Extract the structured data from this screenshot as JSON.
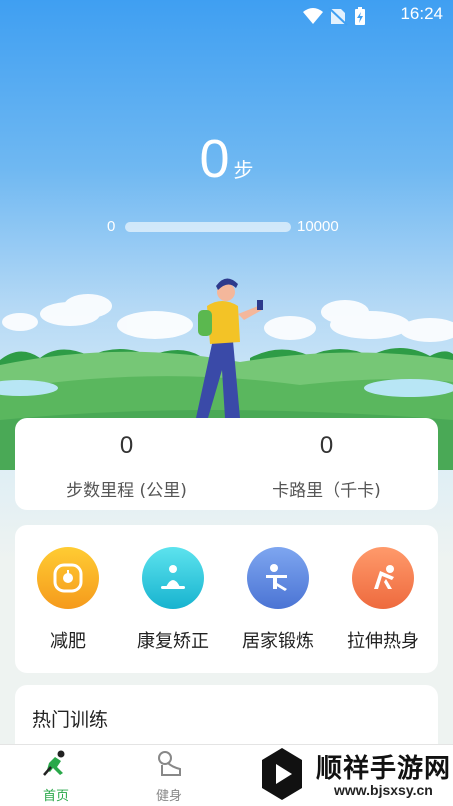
{
  "status_bar": {
    "time": "16:24"
  },
  "steps": {
    "count": "0",
    "unit": "步",
    "min": "0",
    "max": "10000",
    "progress": 0.0
  },
  "stats": [
    {
      "value": "0",
      "label": "步数里程 (公里)"
    },
    {
      "value": "0",
      "label": "卡路里（千卡)"
    }
  ],
  "features": [
    {
      "label": "减肥",
      "icon": "scale-icon",
      "color": "#f5a623"
    },
    {
      "label": "康复矫正",
      "icon": "meditation-icon",
      "color": "#27c8d8"
    },
    {
      "label": "居家锻炼",
      "icon": "exercise-icon",
      "color": "#5f8be0"
    },
    {
      "label": "拉伸热身",
      "icon": "stretch-icon",
      "color": "#f2784b"
    }
  ],
  "training": {
    "title": "热门训练"
  },
  "nav": [
    {
      "label": "首页",
      "icon": "running-icon",
      "active": true
    },
    {
      "label": "健身",
      "icon": "fitness-icon",
      "active": false
    }
  ],
  "watermark": {
    "title": "顺祥手游网",
    "subtitle": "www.bjsxsy.cn"
  },
  "colors": {
    "accent": "#2aa84a",
    "sky": "#3f9ff2"
  }
}
